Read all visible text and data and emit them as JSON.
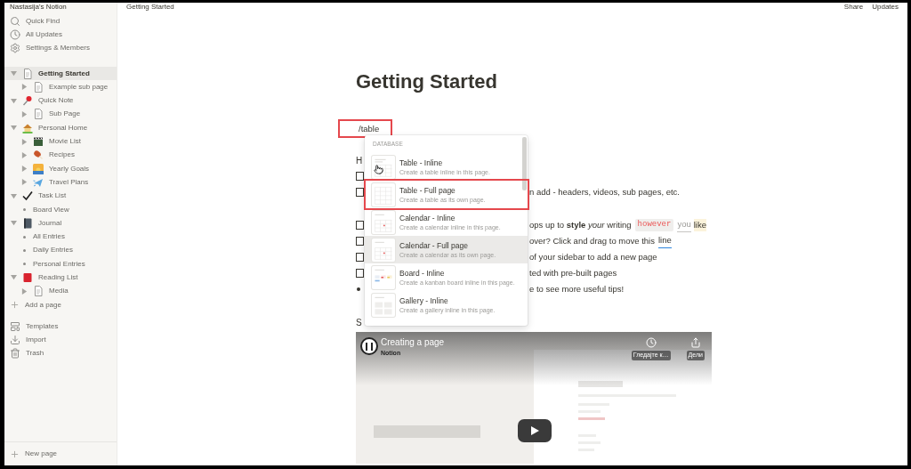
{
  "workspace": {
    "name": "Nastasija's Notion"
  },
  "sidebar": {
    "top_items": [
      {
        "label": "Quick Find",
        "kind": "search"
      },
      {
        "label": "All Updates",
        "kind": "clock"
      },
      {
        "label": "Settings & Members",
        "kind": "gear"
      }
    ],
    "pages": [
      {
        "label": "Getting Started",
        "kind": "doc",
        "expanded": true,
        "selected": true,
        "children": [
          {
            "label": "Example sub page",
            "kind": "doc",
            "expanded": false,
            "selected": false
          }
        ]
      },
      {
        "label": "Quick Note",
        "kind": "pin",
        "expanded": true,
        "selected": false,
        "children": [
          {
            "label": "Sub Page",
            "kind": "doc",
            "expanded": false,
            "selected": false
          }
        ]
      },
      {
        "label": "Personal Home",
        "kind": "house",
        "expanded": true,
        "selected": false,
        "children": [
          {
            "label": "Movie List",
            "kind": "film",
            "expanded": false,
            "selected": false
          },
          {
            "label": "Recipes",
            "kind": "food",
            "expanded": false,
            "selected": false
          },
          {
            "label": "Yearly Goals",
            "kind": "sunset",
            "expanded": false,
            "selected": false
          },
          {
            "label": "Travel Plans",
            "kind": "plane",
            "expanded": false,
            "selected": false
          }
        ]
      },
      {
        "label": "Task List",
        "kind": "check",
        "expanded": true,
        "selected": false,
        "children": [
          {
            "label": "Board View",
            "kind": "bullet",
            "selected": false
          }
        ]
      },
      {
        "label": "Journal",
        "kind": "book",
        "expanded": true,
        "selected": false,
        "children": [
          {
            "label": "All Entries",
            "kind": "bullet",
            "selected": false
          },
          {
            "label": "Daily Entries",
            "kind": "bullet",
            "selected": false
          },
          {
            "label": "Personal Entries",
            "kind": "bullet",
            "selected": false
          }
        ]
      },
      {
        "label": "Reading List",
        "kind": "redbook",
        "expanded": true,
        "selected": false,
        "children": [
          {
            "label": "Media",
            "kind": "doc",
            "expanded": false,
            "selected": false
          }
        ]
      }
    ],
    "add_page": "Add a page",
    "bottom_items": [
      {
        "label": "Templates",
        "kind": "templates"
      },
      {
        "label": "Import",
        "kind": "import"
      },
      {
        "label": "Trash",
        "kind": "trash"
      }
    ],
    "new_page": "New page"
  },
  "topbar": {
    "breadcrumb": "Getting Started",
    "actions": [
      "Share",
      "Updates"
    ]
  },
  "page": {
    "title": "Getting Started",
    "command": "/table",
    "lines": [
      {
        "kind": "heading",
        "text": "H"
      },
      {
        "kind": "todo",
        "checked": false
      },
      {
        "kind": "todo",
        "checked": false,
        "text": "n add - headers, videos, sub pages, etc."
      },
      {
        "kind": "gap"
      },
      {
        "kind": "todo",
        "checked": false,
        "text": "ops up to **style** *your* writing",
        "code": "however",
        "tail": "you",
        "mark": "like"
      },
      {
        "kind": "todo",
        "checked": false,
        "text": "over? Click and drag to move this",
        "link": "line"
      },
      {
        "kind": "todo",
        "checked": false,
        "text": "of your sidebar to add a new page"
      },
      {
        "kind": "todo",
        "checked": false,
        "text": "ted with pre-built pages"
      },
      {
        "kind": "bullet",
        "text": "e to see more useful tips!"
      },
      {
        "kind": "partial",
        "text": "S"
      }
    ],
    "video": {
      "title": "Creating a page",
      "channel": "Notion",
      "actions": [
        {
          "label": "Гледајте к…",
          "kind": "clock"
        },
        {
          "label": "Дели",
          "kind": "share"
        }
      ]
    }
  },
  "menu": {
    "section": "DATABASE",
    "items": [
      {
        "title": "Table - Inline",
        "description": "Create a table inline in this page.",
        "kind": "table",
        "selected": false,
        "annotated": false
      },
      {
        "title": "Table - Full page",
        "description": "Create a table as its own page.",
        "kind": "table-full",
        "selected": false,
        "annotated": true
      },
      {
        "title": "Calendar - Inline",
        "description": "Create a calendar inline in this page.",
        "kind": "calendar",
        "selected": false,
        "annotated": false
      },
      {
        "title": "Calendar - Full page",
        "description": "Create a calendar as its own page.",
        "kind": "calendar",
        "selected": true,
        "annotated": false
      },
      {
        "title": "Board - Inline",
        "description": "Create a kanban board inline in this page.",
        "kind": "board",
        "selected": false,
        "annotated": false
      },
      {
        "title": "Gallery - Inline",
        "description": "Create a gallery inline in this page.",
        "kind": "gallery",
        "selected": false,
        "annotated": false
      }
    ]
  }
}
